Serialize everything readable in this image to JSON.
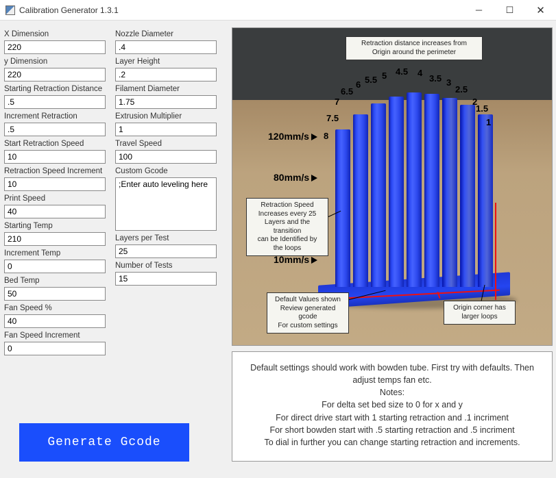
{
  "window": {
    "title": "Calibration Generator 1.3.1"
  },
  "col1": {
    "xdim": {
      "label": "X Dimension",
      "value": "220"
    },
    "ydim": {
      "label": "y Dimension",
      "value": "220"
    },
    "startRetr": {
      "label": "Starting Retraction Distance",
      "value": ".5"
    },
    "incRetr": {
      "label": "Increment Retraction",
      "value": ".5"
    },
    "startRetrSpd": {
      "label": "Start Retraction Speed",
      "value": "10"
    },
    "retrSpdInc": {
      "label": "Retraction Speed Increment",
      "value": "10"
    },
    "printSpd": {
      "label": "Print Speed",
      "value": "40"
    },
    "startTemp": {
      "label": "Starting Temp",
      "value": "210"
    },
    "incTemp": {
      "label": "Increment Temp",
      "value": "0"
    },
    "bedTemp": {
      "label": "Bed Temp",
      "value": "50"
    },
    "fanPct": {
      "label": "Fan Speed %",
      "value": "40"
    },
    "fanInc": {
      "label": "Fan Speed Increment",
      "value": "0"
    }
  },
  "col2": {
    "nozzle": {
      "label": "Nozzle Diameter",
      "value": ".4"
    },
    "layerH": {
      "label": "Layer Height",
      "value": ".2"
    },
    "filDia": {
      "label": "Filament Diameter",
      "value": "1.75"
    },
    "extMult": {
      "label": "Extrusion Multiplier",
      "value": "1"
    },
    "travel": {
      "label": "Travel Speed",
      "value": "100"
    },
    "gcode": {
      "label": "Custom Gcode",
      "value": ";Enter auto leveling here"
    },
    "layersPer": {
      "label": "Layers per Test",
      "value": "25"
    },
    "numTests": {
      "label": "Number of Tests",
      "value": "15"
    }
  },
  "button": {
    "generate": "Generate Gcode"
  },
  "image": {
    "topBox": "Retraction distance increases from\nOrigin around the perimeter",
    "spdBox": "Retraction Speed\nIncreases every 25\nLayers and the transition\ncan be Identified by\nthe loops",
    "defBox": "Default Values shown\nReview generated gcode\nFor custom settings",
    "originBox": "Origin corner has\nlarger loops",
    "spd120": "120mm/s",
    "spd80": "80mm/s",
    "spd10": "10mm/s",
    "n1": "1",
    "n15": "1.5",
    "n2": "2",
    "n25": "2.5",
    "n3": "3",
    "n35": "3.5",
    "n4": "4",
    "n45": "4.5",
    "n5": "5",
    "n55": "5.5",
    "n6": "6",
    "n65": "6.5",
    "n7": "7",
    "n75": "7.5",
    "n8": "8"
  },
  "notes": {
    "l1": "Default settings should work with bowden tube. First try with defaults. Then adjust temps fan etc.",
    "l2": "Notes:",
    "l3": "For delta set bed size to 0 for x and y",
    "l4": "For direct drive start with 1 starting retraction and .1 incriment",
    "l5": "For short bowden start with .5 starting retraction and .5 incriment",
    "l6": "To dial in further you can change starting retraction and increments."
  }
}
